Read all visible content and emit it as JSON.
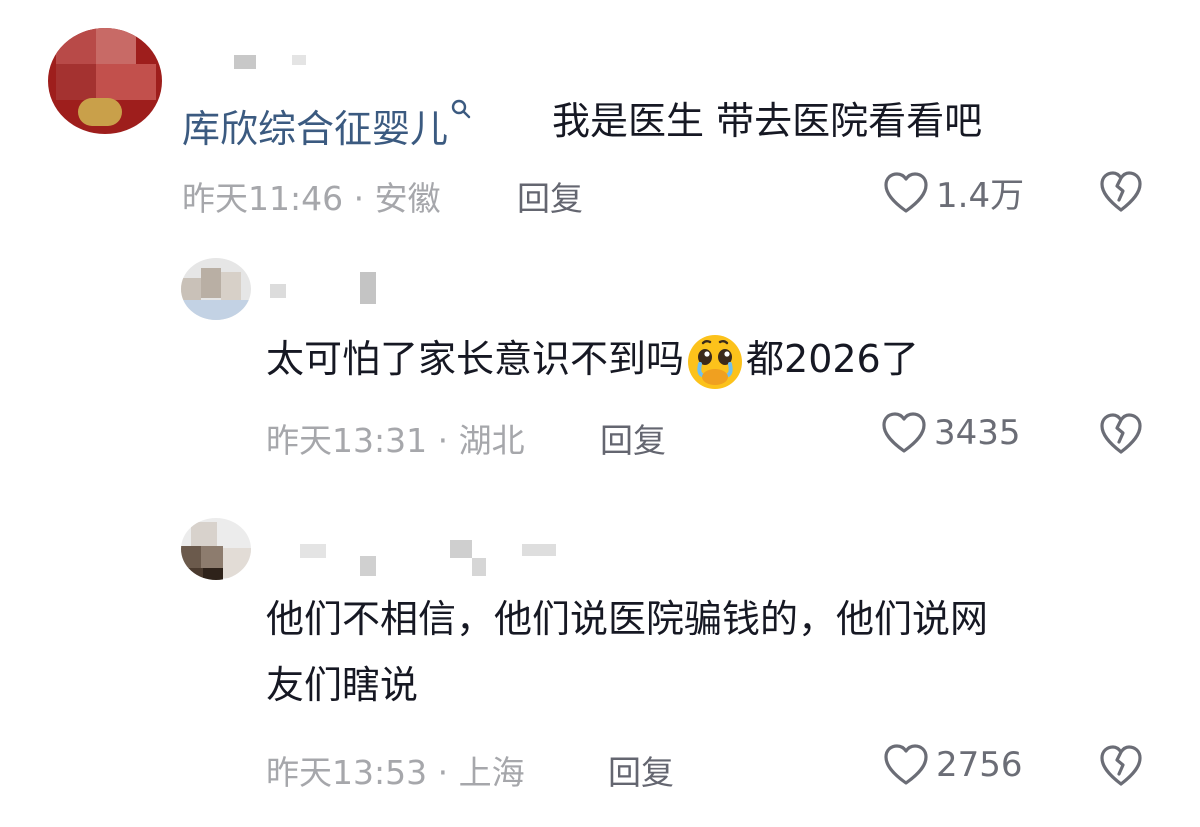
{
  "comments": [
    {
      "username": "库欣综合征婴儿",
      "text": "我是医生 带去医院看看吧",
      "time": "昨天11:46",
      "location": "安徽",
      "reply_label": "回复",
      "likes": "1.4万"
    },
    {
      "text_before": "太可怕了家长意识不到吗",
      "emoji": "pleading-crying-face",
      "text_after": "都2026了",
      "time": "昨天13:31",
      "location": "湖北",
      "reply_label": "回复",
      "likes": "3435"
    },
    {
      "text_line1": "他们不相信，他们说医院骗钱的，他们说网",
      "text_line2": "友们瞎说",
      "time": "昨天13:53",
      "location": "上海",
      "reply_label": "回复",
      "likes": "2756"
    }
  ],
  "colors": {
    "username": "#3b5a80",
    "meta": "#a6a7ab",
    "text": "#161823"
  },
  "icons": [
    "search-icon",
    "heart-icon",
    "broken-heart-icon",
    "pleading-face-emoji"
  ],
  "separator": "·"
}
